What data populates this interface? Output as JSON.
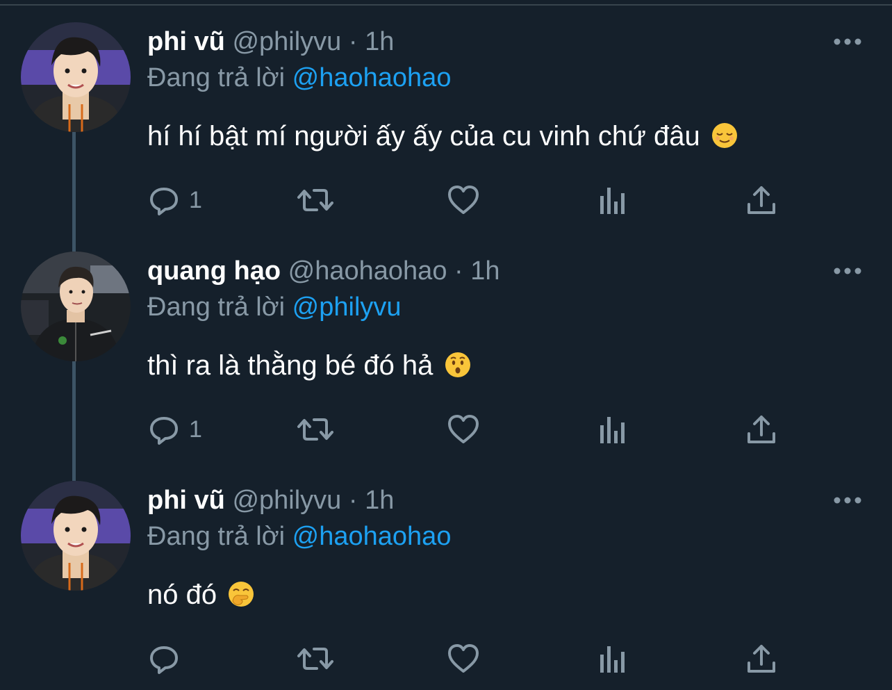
{
  "tweets": [
    {
      "name": "phi vũ",
      "handle": "@philyvu",
      "separator": "·",
      "time": "1h",
      "reply_prefix": "Đang trả lời",
      "reply_to": "@haohaohao",
      "text": "hí hí bật mí người ấy ấy của cu vinh chứ đâu",
      "emoji": "relieved-face-emoji",
      "reply_count": "1",
      "avatar": "avatar-philyvu"
    },
    {
      "name": "quang hạo",
      "handle": "@haohaohao",
      "separator": "·",
      "time": "1h",
      "reply_prefix": "Đang trả lời",
      "reply_to": "@philyvu",
      "text": "thì ra là thằng bé đó hả",
      "emoji": "hushed-face-emoji",
      "reply_count": "1",
      "avatar": "avatar-haohaohao"
    },
    {
      "name": "phi vũ",
      "handle": "@philyvu",
      "separator": "·",
      "time": "1h",
      "reply_prefix": "Đang trả lời",
      "reply_to": "@haohaohao",
      "text": "nó đó",
      "emoji": "hand-over-mouth-emoji",
      "reply_count": "",
      "avatar": "avatar-philyvu"
    }
  ],
  "colors": {
    "background": "#15202b",
    "text_primary": "#ffffff",
    "text_secondary": "#8899a6",
    "link": "#1da1f2",
    "thread_line": "#3d5466"
  },
  "icons": [
    "reply-icon",
    "retweet-icon",
    "like-icon",
    "analytics-icon",
    "share-icon",
    "more-icon"
  ]
}
